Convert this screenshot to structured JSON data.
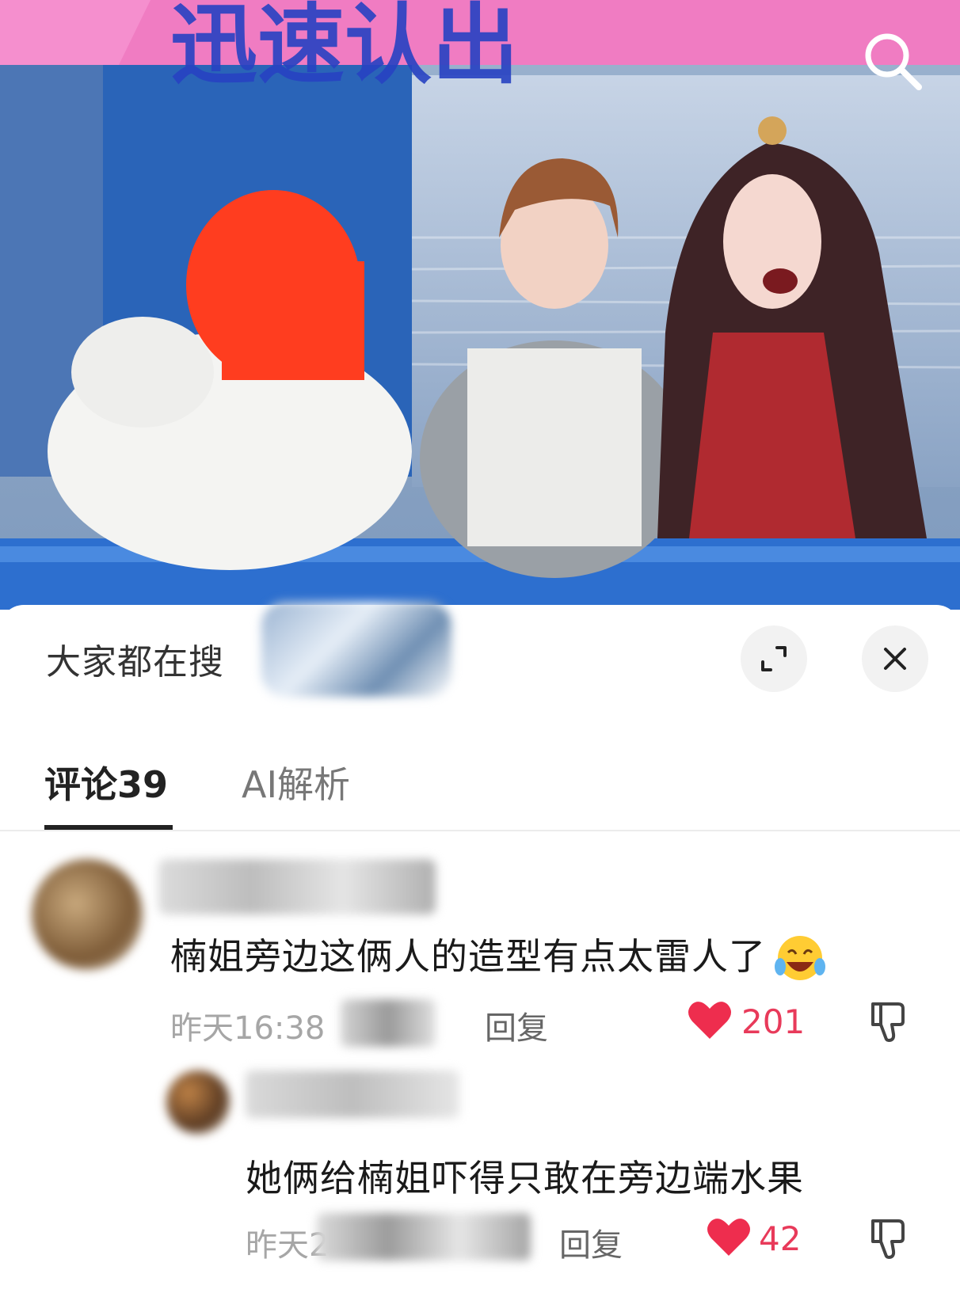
{
  "video": {
    "overlay_text": "迅速认出",
    "search_icon": "search-icon"
  },
  "sheet": {
    "title": "大家都在搜",
    "expand_icon": "expand-icon",
    "close_icon": "close-icon"
  },
  "tabs": [
    {
      "label": "评论39",
      "active": true
    },
    {
      "label": "AI解析",
      "active": false
    }
  ],
  "comments": [
    {
      "text": "楠姐旁边这俩人的造型有点太雷人了",
      "emoji": "laughing-crying-emoji",
      "time": "昨天16:38",
      "reply_label": "回复",
      "likes": "201"
    },
    {
      "text": "她俩给楠姐吓得只敢在旁边端水果",
      "time": "昨天2",
      "reply_label": "回复",
      "likes": "42"
    }
  ],
  "colors": {
    "like_red": "#e83a5a",
    "muted": "#a6a6a6",
    "background": "#ffffff"
  }
}
